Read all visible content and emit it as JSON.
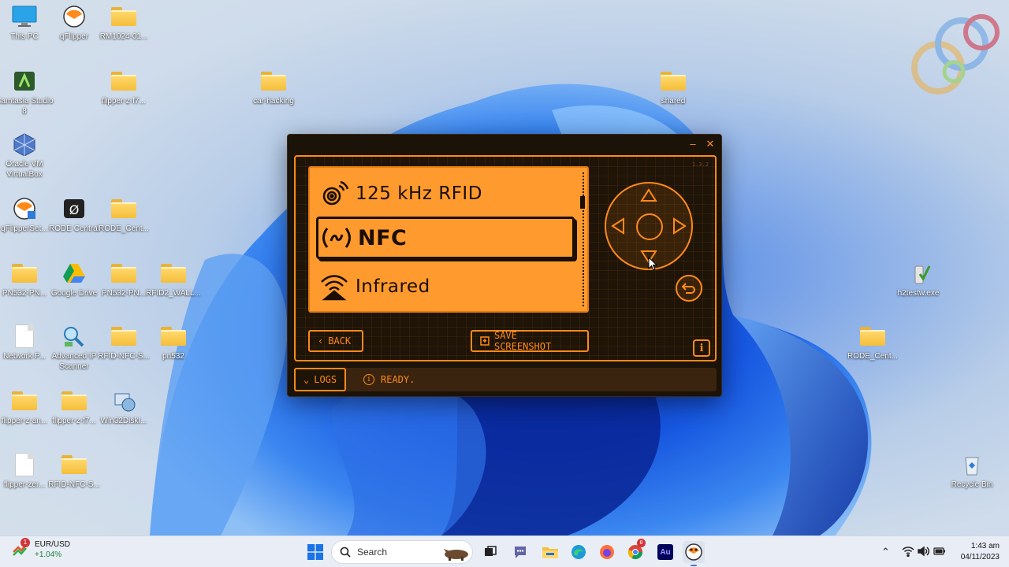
{
  "desktop": {
    "icons": [
      {
        "label": "This PC",
        "kind": "pc"
      },
      {
        "label": "qFlipper",
        "kind": "app"
      },
      {
        "label": "RM1024-01...",
        "kind": "folder"
      },
      {
        "label": "Camtasia Studio 8",
        "kind": "app"
      },
      {
        "label": "flipper-z-f7...",
        "kind": "folder"
      },
      {
        "label": "car-hacking",
        "kind": "folder"
      },
      {
        "label": "shared",
        "kind": "folder"
      },
      {
        "label": "Oracle VM VirtualBox",
        "kind": "app"
      },
      {
        "label": "qFlipperSet...",
        "kind": "app"
      },
      {
        "label": "RODE Central",
        "kind": "app"
      },
      {
        "label": "RODE_Cent...",
        "kind": "folder"
      },
      {
        "label": "PN532-PN...",
        "kind": "folder"
      },
      {
        "label": "Google Drive",
        "kind": "app"
      },
      {
        "label": "PN532-PN...",
        "kind": "folder"
      },
      {
        "label": "RFID2_WALL...",
        "kind": "folder"
      },
      {
        "label": "h2testw.exe",
        "kind": "app"
      },
      {
        "label": "Network-P...",
        "kind": "doc"
      },
      {
        "label": "Advanced IP Scanner",
        "kind": "app"
      },
      {
        "label": "RFID-NFC-S...",
        "kind": "folder"
      },
      {
        "label": "pn532",
        "kind": "folder"
      },
      {
        "label": "RODE_Cent...",
        "kind": "folder"
      },
      {
        "label": "flipper-z-an...",
        "kind": "folder"
      },
      {
        "label": "flipper-z-f7...",
        "kind": "folder"
      },
      {
        "label": "Win32DiskI...",
        "kind": "app"
      },
      {
        "label": "flipper-zer...",
        "kind": "doc"
      },
      {
        "label": "RFID-NFC-S...",
        "kind": "folder"
      },
      {
        "label": "Recycle Bin",
        "kind": "app"
      }
    ]
  },
  "flipper": {
    "version": "1.3.2",
    "menu": [
      {
        "label": "125 kHz RFID",
        "icon": "rfid-icon"
      },
      {
        "label": "NFC",
        "icon": "nfc-icon"
      },
      {
        "label": "Infrared",
        "icon": "infrared-icon"
      }
    ],
    "back_label": "BACK",
    "save_label": "SAVE SCREENSHOT",
    "logs_label": "LOGS",
    "status_text": "READY.",
    "accent": "#ff8a1a",
    "screen_color": "#ff9a2e"
  },
  "taskbar": {
    "ticker_name": "EUR/USD",
    "ticker_change": "+1.04%",
    "ticker_badge": "1",
    "search_placeholder": "Search",
    "chrome_badge": "8",
    "au_label": "Au",
    "time": "1:43 am",
    "date": "04/11/2023"
  }
}
